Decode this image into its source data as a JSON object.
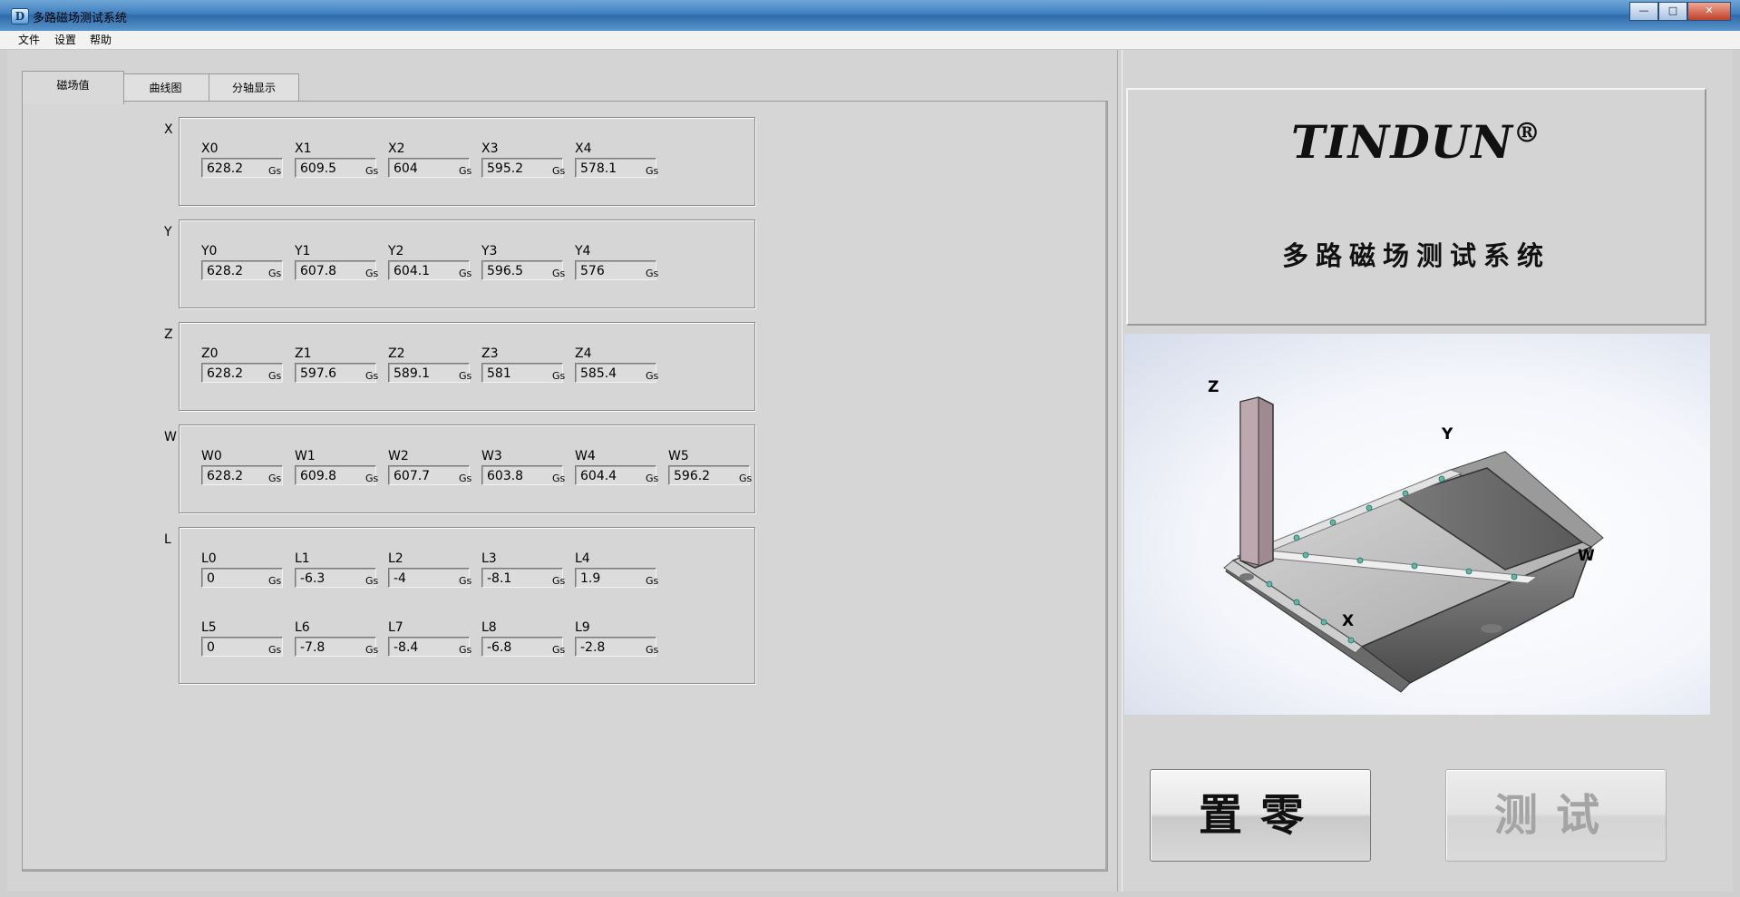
{
  "window": {
    "title": "多路磁场测试系统",
    "icon_text": "D",
    "buttons": [
      "—",
      "□",
      "✕"
    ]
  },
  "menu": {
    "items": [
      "文件",
      "设置",
      "帮助"
    ]
  },
  "tabs": [
    {
      "label": "磁场值"
    },
    {
      "label": "曲线图"
    },
    {
      "label": "分轴显示"
    }
  ],
  "unit": "Gs",
  "groups": [
    {
      "label": "X",
      "channels": [
        {
          "name": "X0",
          "value": "628.2"
        },
        {
          "name": "X1",
          "value": "609.5"
        },
        {
          "name": "X2",
          "value": "604"
        },
        {
          "name": "X3",
          "value": "595.2"
        },
        {
          "name": "X4",
          "value": "578.1"
        }
      ]
    },
    {
      "label": "Y",
      "channels": [
        {
          "name": "Y0",
          "value": "628.2"
        },
        {
          "name": "Y1",
          "value": "607.8"
        },
        {
          "name": "Y2",
          "value": "604.1"
        },
        {
          "name": "Y3",
          "value": "596.5"
        },
        {
          "name": "Y4",
          "value": "576"
        }
      ]
    },
    {
      "label": "Z",
      "channels": [
        {
          "name": "Z0",
          "value": "628.2"
        },
        {
          "name": "Z1",
          "value": "597.6"
        },
        {
          "name": "Z2",
          "value": "589.1"
        },
        {
          "name": "Z3",
          "value": "581"
        },
        {
          "name": "Z4",
          "value": "585.4"
        }
      ]
    },
    {
      "label": "W",
      "channels": [
        {
          "name": "W0",
          "value": "628.2"
        },
        {
          "name": "W1",
          "value": "609.8"
        },
        {
          "name": "W2",
          "value": "607.7"
        },
        {
          "name": "W3",
          "value": "603.8"
        },
        {
          "name": "W4",
          "value": "604.4"
        },
        {
          "name": "W5",
          "value": "596.2"
        }
      ]
    },
    {
      "label": "L",
      "channels": [
        {
          "name": "L0",
          "value": "0"
        },
        {
          "name": "L1",
          "value": "-6.3"
        },
        {
          "name": "L2",
          "value": "-4"
        },
        {
          "name": "L3",
          "value": "-8.1"
        },
        {
          "name": "L4",
          "value": "1.9"
        },
        {
          "name": "L5",
          "value": "0"
        },
        {
          "name": "L6",
          "value": "-7.8"
        },
        {
          "name": "L7",
          "value": "-8.4"
        },
        {
          "name": "L8",
          "value": "-6.8"
        },
        {
          "name": "L9",
          "value": "-2.8"
        }
      ]
    }
  ],
  "logo": {
    "brand": "TINDUN",
    "registered": "®",
    "system_name": "多路磁场测试系统"
  },
  "diagram": {
    "labels": {
      "z": "Z",
      "y": "Y",
      "w": "W",
      "x": "X"
    }
  },
  "actions": {
    "zero": "置零",
    "test": "测试"
  }
}
